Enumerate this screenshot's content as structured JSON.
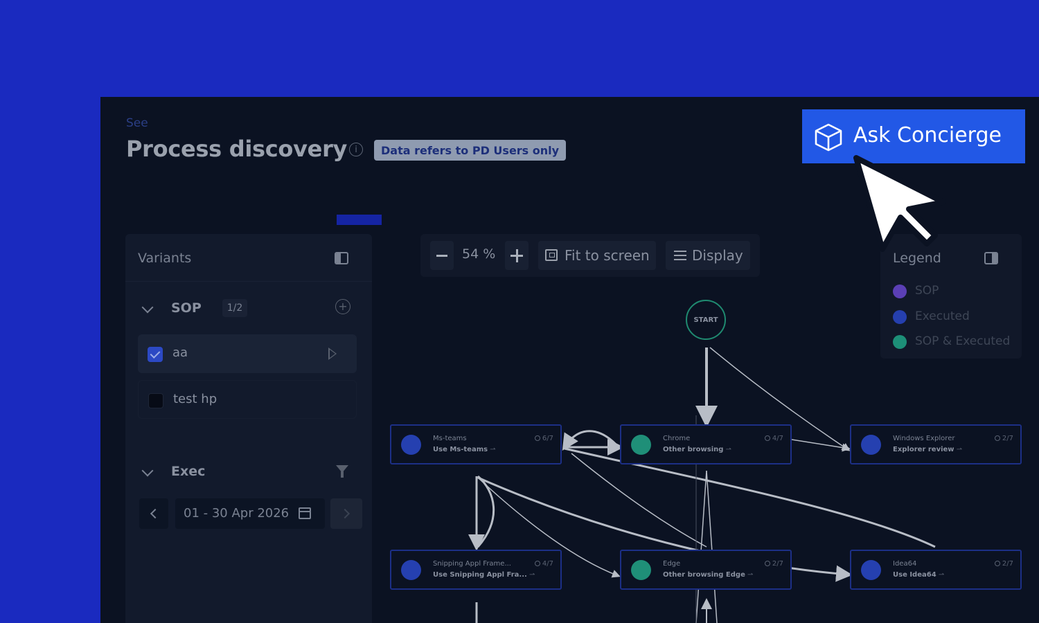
{
  "header": {
    "breadcrumb": "See",
    "title": "Process discovery",
    "badge": "Data refers to PD Users only"
  },
  "variants": {
    "title": "Variants",
    "sop": {
      "label": "SOP",
      "count": "1/2",
      "items": [
        {
          "label": "aa",
          "checked": true
        },
        {
          "label": "test hp",
          "checked": false
        }
      ]
    },
    "exec": {
      "label": "Exec",
      "date_range": "01 - 30 Apr 2026"
    }
  },
  "toolbar": {
    "zoom": "54 %",
    "fit_label": "Fit to screen",
    "display_label": "Display"
  },
  "legend": {
    "title": "Legend",
    "items": [
      {
        "label": "SOP",
        "color": "#5b3fb5"
      },
      {
        "label": "Executed",
        "color": "#253fae"
      },
      {
        "label": "SOP & Executed",
        "color": "#1d8f78"
      }
    ]
  },
  "graph": {
    "start_label": "START",
    "nodes": [
      {
        "app": "Ms-teams",
        "activity": "Use Ms-teams",
        "count": "6/7",
        "color": "#2540b0"
      },
      {
        "app": "Chrome",
        "activity": "Other browsing",
        "count": "4/7",
        "color": "#1f8f78"
      },
      {
        "app": "Windows Explorer",
        "activity": "Explorer review",
        "count": "2/7",
        "color": "#2540b0"
      },
      {
        "app": "Snipping Appl Frame...",
        "activity": "Use Snipping Appl Fra...",
        "count": "4/7",
        "color": "#2540b0"
      },
      {
        "app": "Edge",
        "activity": "Other browsing Edge",
        "count": "2/7",
        "color": "#1f8f78"
      },
      {
        "app": "Idea64",
        "activity": "Use Idea64",
        "count": "2/7",
        "color": "#2540b0"
      }
    ]
  },
  "concierge": {
    "label": "Ask Concierge",
    "color": "#2258e6"
  }
}
